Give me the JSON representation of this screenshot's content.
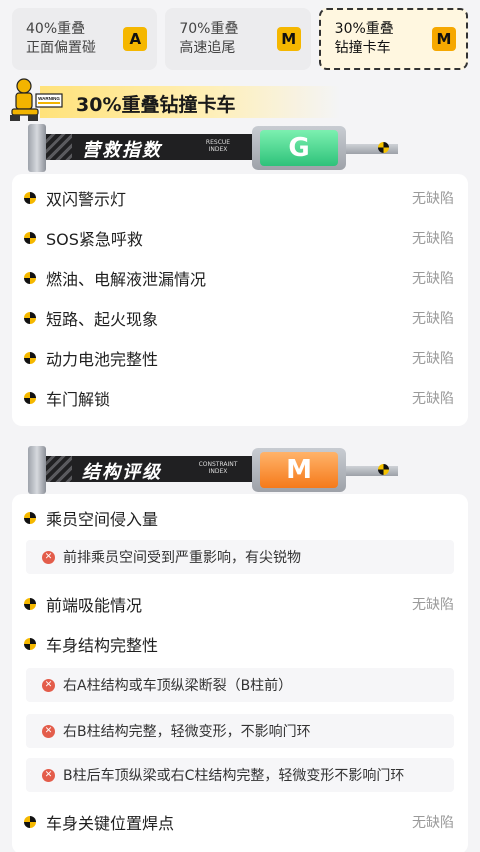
{
  "tabs": [
    {
      "line1": "40%重叠",
      "line2": "正面偏置碰",
      "badge": "A",
      "active": false
    },
    {
      "line1": "70%重叠",
      "line2": "高速追尾",
      "badge": "M",
      "active": false
    },
    {
      "line1": "30%重叠",
      "line2": "钻撞卡车",
      "badge": "M",
      "active": true
    }
  ],
  "section": {
    "title": "30%重叠钻撞卡车",
    "sign_text": "WARNING"
  },
  "rescue": {
    "board_label": "营救指数",
    "board_sub": "RESCUE INDEX",
    "grade": "G",
    "grade_color": "#2ec27a",
    "items": [
      {
        "label": "双闪警示灯",
        "status": "无缺陷"
      },
      {
        "label": "SOS紧急呼救",
        "status": "无缺陷"
      },
      {
        "label": "燃油、电解液泄漏情况",
        "status": "无缺陷"
      },
      {
        "label": "短路、起火现象",
        "status": "无缺陷"
      },
      {
        "label": "动力电池完整性",
        "status": "无缺陷"
      },
      {
        "label": "车门解锁",
        "status": "无缺陷"
      }
    ]
  },
  "structure": {
    "board_label": "结构评级",
    "board_sub": "CONSTRAINT INDEX",
    "grade": "M",
    "grade_color": "#f57a1a",
    "item1": {
      "label": "乘员空间侵入量",
      "issues": [
        "前排乘员空间受到严重影响，有尖锐物"
      ]
    },
    "item2": {
      "label": "前端吸能情况",
      "status": "无缺陷"
    },
    "item3": {
      "label": "车身结构完整性",
      "issues": [
        "右A柱结构或车顶纵梁断裂（B柱前）",
        "右B柱结构完整，轻微变形，不影响门环",
        "B柱后车顶纵梁或右C柱结构完整，轻微变形不影响门环"
      ]
    },
    "item4": {
      "label": "车身关键位置焊点",
      "status": "无缺陷"
    }
  },
  "colors": {
    "accent": "#f5b700",
    "issue_icon": "#e35d4b"
  }
}
